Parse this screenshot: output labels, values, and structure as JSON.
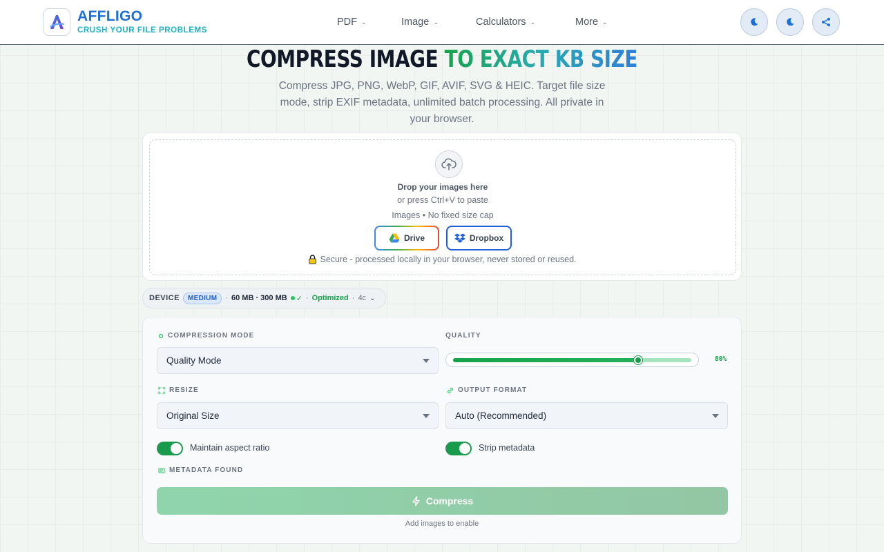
{
  "header": {
    "brand_name": "AFFLIGO",
    "brand_tagline": "CRUSH YOUR FILE PROBLEMS",
    "nav": [
      {
        "label": "PDF"
      },
      {
        "label": "Image"
      },
      {
        "label": "Calculators"
      },
      {
        "label": "More"
      }
    ],
    "actions": [
      "moon-icon",
      "moon-icon",
      "share-icon"
    ]
  },
  "hero": {
    "title_dark": "COMPRESS IMAGE",
    "title_accent": "TO EXACT KB SIZE",
    "subtitle": "Compress JPG, PNG, WebP, GIF, AVIF, SVG & HEIC. Target file size mode, strip EXIF metadata, unlimited batch processing. All private in your browser."
  },
  "upload": {
    "title": "Drop your images here",
    "paste_hint": "or press Ctrl+V to paste",
    "cap": "Images • No fixed size cap",
    "drive_label": "Drive",
    "dropbox_label": "Dropbox",
    "secure_text": "Secure - processed locally in your browser, never stored or reused."
  },
  "device": {
    "label": "DEVICE",
    "tier": "MEDIUM",
    "sep1": "·",
    "memory": "60 MB · 300 MB",
    "check": "✓",
    "sep2": "·",
    "status": "Optimized",
    "sep3": "·",
    "cores": "4c"
  },
  "settings": {
    "compression_mode_label": "COMPRESSION MODE",
    "compression_mode_value": "Quality Mode",
    "quality_label": "QUALITY",
    "quality_value": 80,
    "quality_text": "80%",
    "resize_label": "RESIZE",
    "resize_value": "Original Size",
    "output_format_label": "OUTPUT FORMAT",
    "output_format_value": "Auto (Recommended)",
    "maintain_aspect_label": "Maintain aspect ratio",
    "maintain_aspect_on": true,
    "strip_metadata_label": "Strip metadata",
    "strip_metadata_on": true,
    "metadata_found_label": "METADATA FOUND",
    "compress_label": "Compress",
    "enable_hint": "Add images to enable"
  },
  "colors": {
    "brand": "#1d6fd8",
    "accent_green": "#16a34a",
    "tagline": "#19b2c7"
  }
}
